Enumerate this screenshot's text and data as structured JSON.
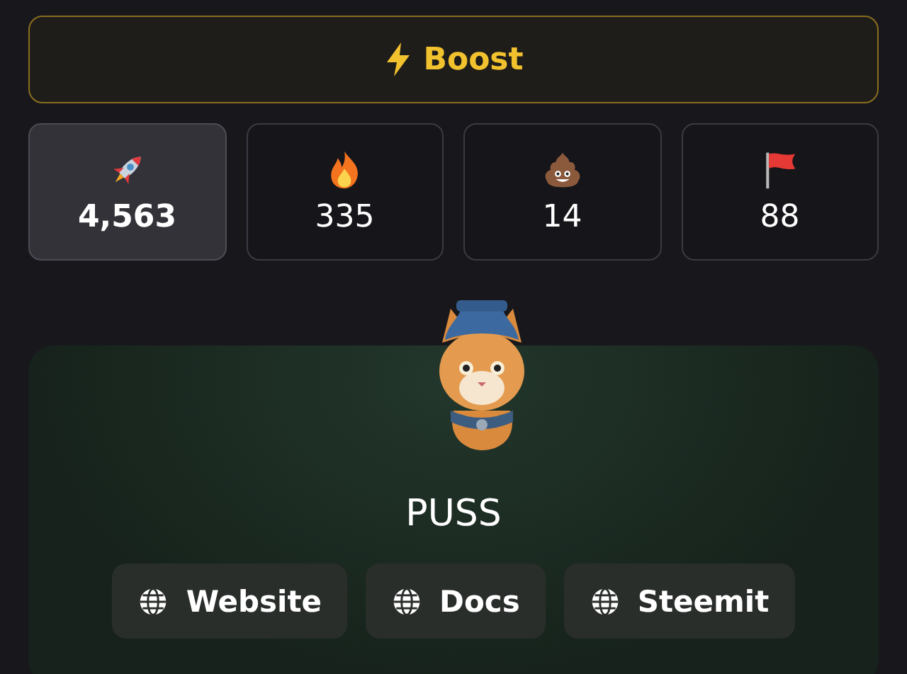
{
  "boost_button": {
    "label": "Boost"
  },
  "stats": [
    {
      "kind": "rocket",
      "value": "4,563",
      "selected": true
    },
    {
      "kind": "fire",
      "value": "335",
      "selected": false
    },
    {
      "kind": "poop",
      "value": "14",
      "selected": false
    },
    {
      "kind": "flag",
      "value": "88",
      "selected": false
    }
  ],
  "token": {
    "name": "PUSS"
  },
  "links": [
    {
      "label": "Website"
    },
    {
      "label": "Docs"
    },
    {
      "label": "Steemit"
    }
  ]
}
